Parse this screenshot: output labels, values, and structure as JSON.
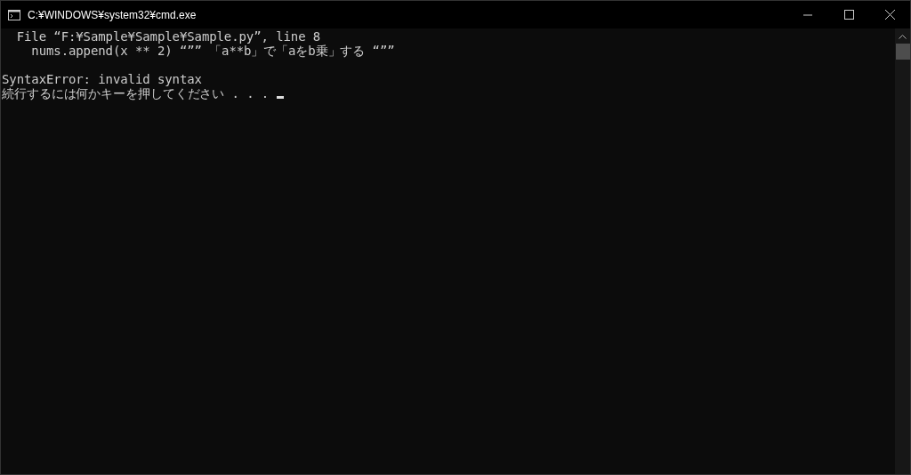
{
  "window": {
    "title": "C:¥WINDOWS¥system32¥cmd.exe"
  },
  "console": {
    "traceback": [
      "  File “F:¥Sample¥Sample¥Sample.py”, line 8",
      "    nums.append(x ** 2) “”” 「a**b」で「aをb乗」する “””"
    ],
    "error": "SyntaxError: invalid syntax",
    "prompt": "続行するには何かキーを押してください . . . "
  }
}
